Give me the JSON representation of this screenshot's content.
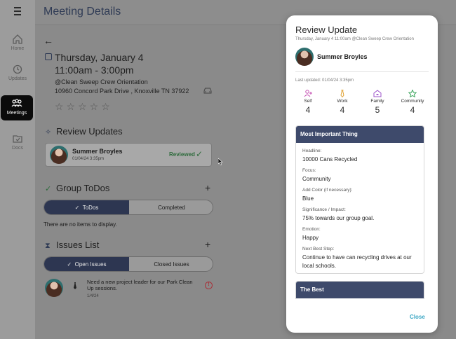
{
  "app": {
    "page_title": "Meeting Details",
    "nav": [
      {
        "label": "Home",
        "icon": "home-icon"
      },
      {
        "label": "Updates",
        "icon": "updates-icon"
      },
      {
        "label": "Meetings",
        "icon": "meetings-icon"
      },
      {
        "label": "Docs",
        "icon": "docs-icon"
      }
    ]
  },
  "meeting": {
    "date": "Thursday, January 4",
    "time": "11:00am - 3:00pm",
    "organization": "@Clean Sweep Crew Orientation",
    "address": "10960 Concord Park Drive , Knoxville TN 37922",
    "rating_stars": "☆☆☆☆☆"
  },
  "review_updates": {
    "title": "Review Updates",
    "card": {
      "name": "Summer Broyles",
      "date": "01/04/24 3:35pm",
      "status": "Reviewed"
    }
  },
  "group_todos": {
    "title": "Group ToDos",
    "tabs": [
      "ToDos",
      "Completed"
    ],
    "empty_message": "There are no items to display."
  },
  "issues": {
    "title": "Issues List",
    "tabs": [
      "Open Issues",
      "Closed Issues"
    ],
    "item": {
      "text": "Need a new project leader for our Park Clean Up sessions.",
      "date": "1/4/24"
    }
  },
  "modal": {
    "title": "Review Update",
    "subtitle": "Thursday, January 4 11:00am @Clean Sweep Crew Orientation",
    "name": "Summer Broyles",
    "last_updated": "Last updated: 01/04/24 3:35pm",
    "stats": [
      {
        "label": "Self",
        "value": "4",
        "icon": "person-add-icon",
        "color": "#c44fb2"
      },
      {
        "label": "Work",
        "value": "4",
        "icon": "tie-icon",
        "color": "#e0a030"
      },
      {
        "label": "Family",
        "value": "5",
        "icon": "house-icon",
        "color": "#9b50c8"
      },
      {
        "label": "Community",
        "value": "4",
        "icon": "star-icon",
        "color": "#3ba55c"
      }
    ],
    "section1": {
      "header": "Most Important Thing",
      "fields": [
        {
          "label": "Headline:",
          "value": "10000 Cans Recycled"
        },
        {
          "label": "Focus:",
          "value": "Community"
        },
        {
          "label": "Add Color (if necessary):",
          "value": "Blue"
        },
        {
          "label": "Significance / Impact:",
          "value": "75% towards our group goal."
        },
        {
          "label": "Emotion:",
          "value": "Happy"
        },
        {
          "label": "Next Best Step:",
          "value": "Continue to have can recycling drives at our local schools."
        }
      ]
    },
    "section2": {
      "header": "The Best"
    },
    "close_label": "Close"
  },
  "colors": {
    "panel_header": "#3e4a6b",
    "toggle_active": "#2d3651",
    "reviewed_green": "#2e6b3c",
    "close_link": "#3aa6c4",
    "alert_red": "#a8333b"
  }
}
